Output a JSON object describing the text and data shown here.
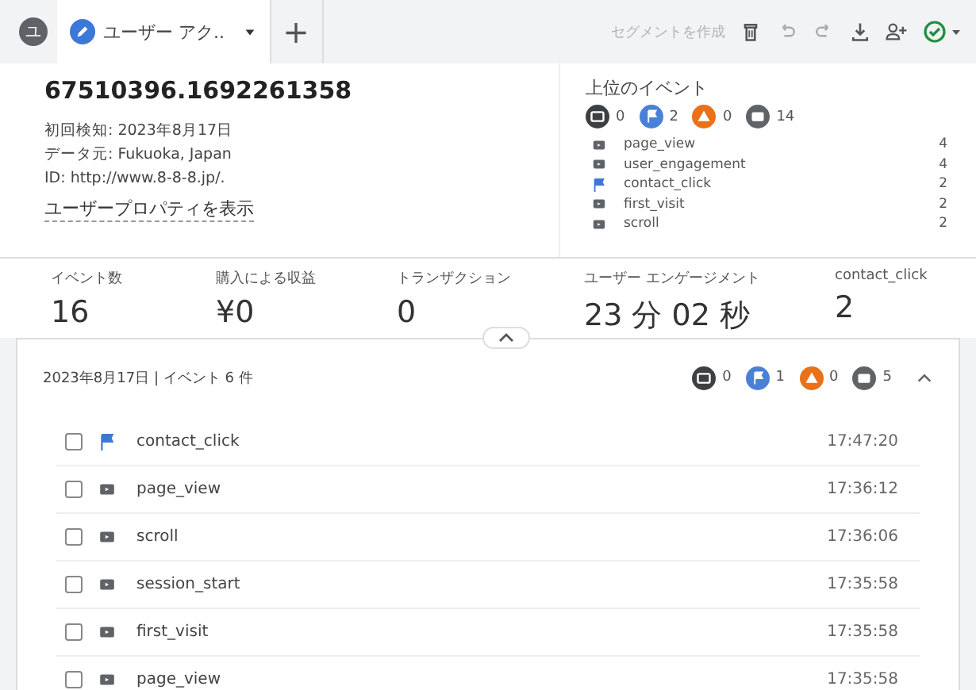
{
  "tabs": {
    "avatar": "ユ",
    "items": [
      {
        "label": "ユーザー アク..",
        "selected": true
      }
    ],
    "add": "+"
  },
  "toolbar": {
    "create_segment": {
      "label": "セグメントを作成",
      "disabled": true
    }
  },
  "user": {
    "id": "67510396.1692261358",
    "first_seen": "初回検知: 2023年8月17日",
    "source": "データ元: Fukuoka, Japan",
    "page_id": "ID: http://www.8-8-8.jp/.",
    "properties_link": "ユーザープロパティを表示"
  },
  "top_events": {
    "title": "上位のイベント",
    "counts": [
      {
        "kind": "message",
        "count": "0"
      },
      {
        "kind": "flag",
        "count": "2"
      },
      {
        "kind": "error",
        "count": "0"
      },
      {
        "kind": "page",
        "count": "14"
      }
    ],
    "items": [
      {
        "kind": "page",
        "name": "page_view",
        "count": "4"
      },
      {
        "kind": "page",
        "name": "user_engagement",
        "count": "4"
      },
      {
        "kind": "flag",
        "name": "contact_click",
        "count": "2"
      },
      {
        "kind": "page",
        "name": "first_visit",
        "count": "2"
      },
      {
        "kind": "page",
        "name": "scroll",
        "count": "2"
      }
    ]
  },
  "metrics": [
    {
      "label": "イベント数",
      "value": "16"
    },
    {
      "label": "購入による収益",
      "value": "¥0"
    },
    {
      "label": "トランザクション",
      "value": "0"
    },
    {
      "label": "ユーザー エンゲージメント",
      "value": "23 分 02 秒"
    },
    {
      "label": "contact_click",
      "value": "2"
    }
  ],
  "timeline": {
    "header": "2023年8月17日 | イベント 6 件",
    "expanded": true,
    "counts": [
      {
        "kind": "message",
        "count": "0"
      },
      {
        "kind": "flag",
        "count": "1"
      },
      {
        "kind": "error",
        "count": "0"
      },
      {
        "kind": "page",
        "count": "5"
      }
    ],
    "rows": [
      {
        "kind": "flag",
        "name": "contact_click",
        "time": "17:47:20",
        "checked": false
      },
      {
        "kind": "page",
        "name": "page_view",
        "time": "17:36:12",
        "checked": false
      },
      {
        "kind": "page",
        "name": "scroll",
        "time": "17:36:06",
        "checked": false
      },
      {
        "kind": "page",
        "name": "session_start",
        "time": "17:35:58",
        "checked": false
      },
      {
        "kind": "page",
        "name": "first_visit",
        "time": "17:35:58",
        "checked": false
      },
      {
        "kind": "page",
        "name": "page_view",
        "time": "17:35:58",
        "checked": false
      }
    ]
  }
}
